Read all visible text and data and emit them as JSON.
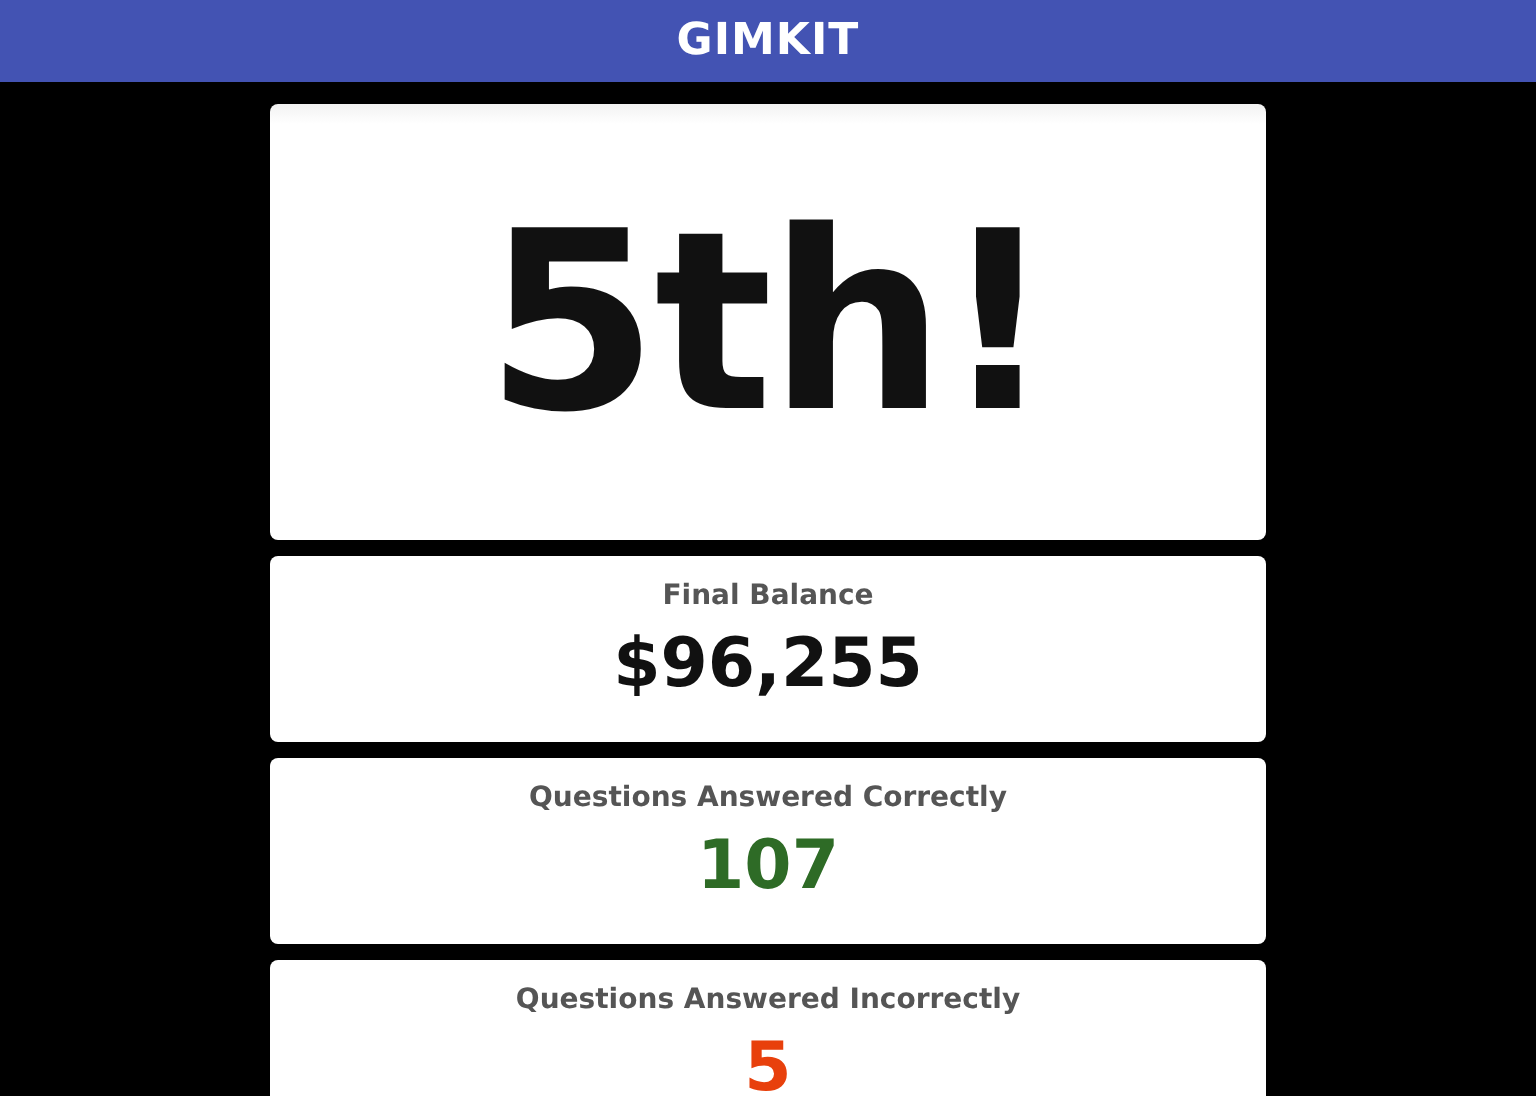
{
  "header": {
    "logo": "GIMKIT"
  },
  "placement": "5th!",
  "stats": [
    {
      "label": "Final Balance",
      "value": "$96,255",
      "color": "#111111"
    },
    {
      "label": "Questions Answered Correctly",
      "value": "107",
      "color": "#2e6b26"
    },
    {
      "label": "Questions Answered Incorrectly",
      "value": "5",
      "color": "#e8400c"
    }
  ]
}
